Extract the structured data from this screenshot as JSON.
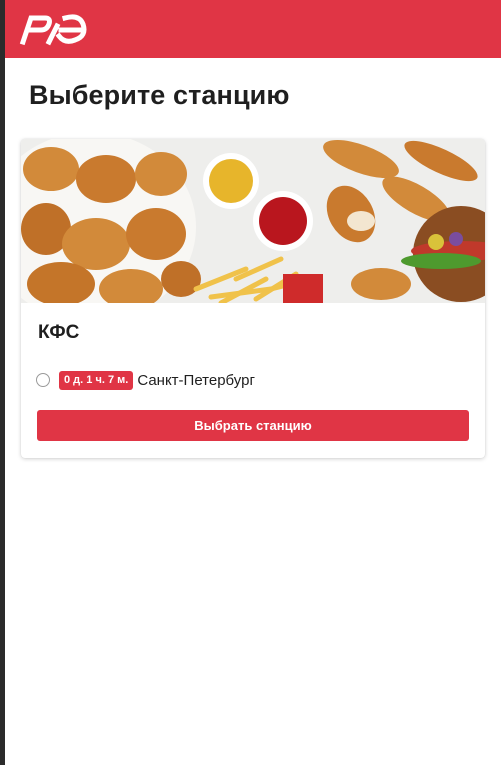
{
  "header": {
    "logo_icon": "rzd-logo-icon",
    "brand_color": "#e03545"
  },
  "page": {
    "title": "Выберите станцию"
  },
  "card": {
    "image_icon": "fried-chicken-food-photo",
    "store_name": "КФС",
    "stations": [
      {
        "time_badge": "0 д. 1 ч. 7 м.",
        "name": "Санкт-Петербург",
        "selected": false
      }
    ],
    "button_label": "Выбрать станцию"
  }
}
